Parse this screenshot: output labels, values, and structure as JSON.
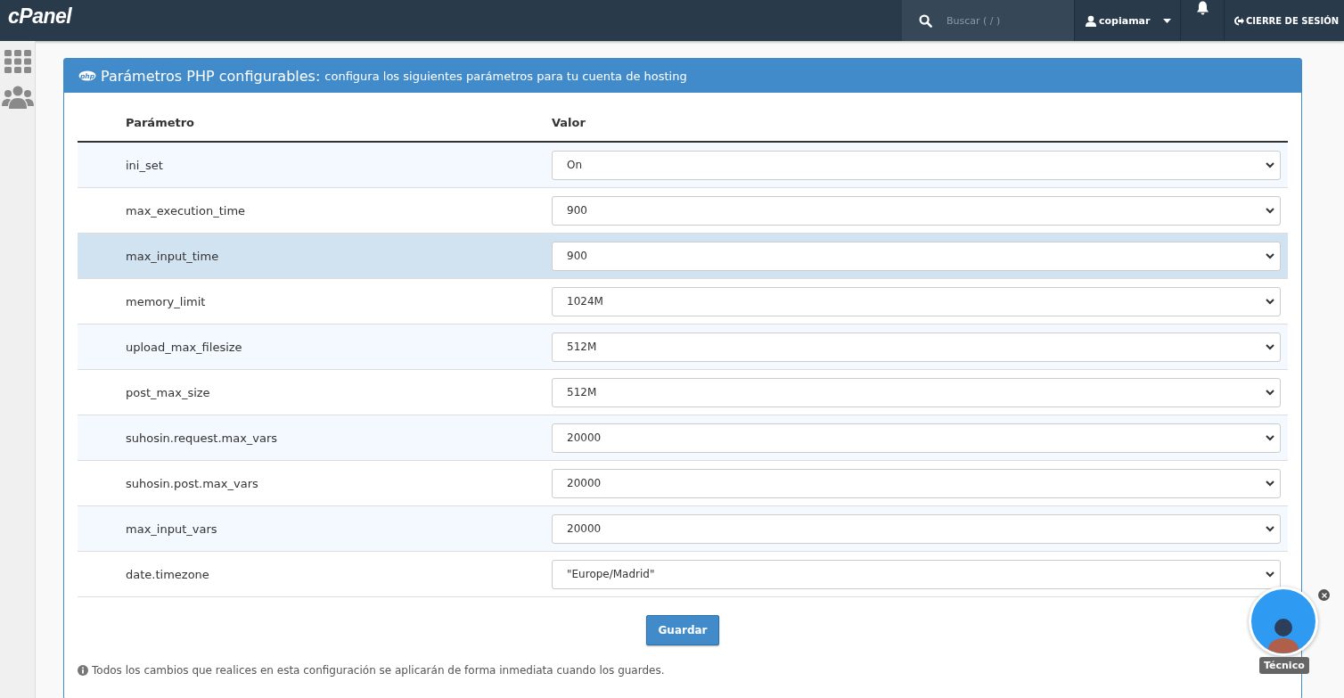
{
  "topbar": {
    "logo": "cPanel",
    "search": {
      "placeholder": "Buscar ( / )"
    },
    "user": "copiamar",
    "logout": "CIERRE DE SESIÓN"
  },
  "panel": {
    "logo_text": "php",
    "title": "Parámetros PHP configurables:",
    "subtitle": "configura los siguientes parámetros para tu cuenta de hosting",
    "columns": [
      "Parámetro",
      "Valor"
    ],
    "rows": [
      {
        "name": "ini_set",
        "value": "On",
        "highlighted": false
      },
      {
        "name": "max_execution_time",
        "value": "900",
        "highlighted": false
      },
      {
        "name": "max_input_time",
        "value": "900",
        "highlighted": true
      },
      {
        "name": "memory_limit",
        "value": "1024M",
        "highlighted": false
      },
      {
        "name": "upload_max_filesize",
        "value": "512M",
        "highlighted": false
      },
      {
        "name": "post_max_size",
        "value": "512M",
        "highlighted": false
      },
      {
        "name": "suhosin.request.max_vars",
        "value": "20000",
        "highlighted": false
      },
      {
        "name": "suhosin.post.max_vars",
        "value": "20000",
        "highlighted": false
      },
      {
        "name": "max_input_vars",
        "value": "20000",
        "highlighted": false
      },
      {
        "name": "date.timezone",
        "value": "\"Europe/Madrid\"",
        "highlighted": false
      }
    ],
    "save_button": "Guardar",
    "note": "Todos los cambios que realices en esta configuración se aplicarán de forma inmediata cuando los guardes."
  },
  "chat_widget": {
    "label": "Técnico"
  }
}
